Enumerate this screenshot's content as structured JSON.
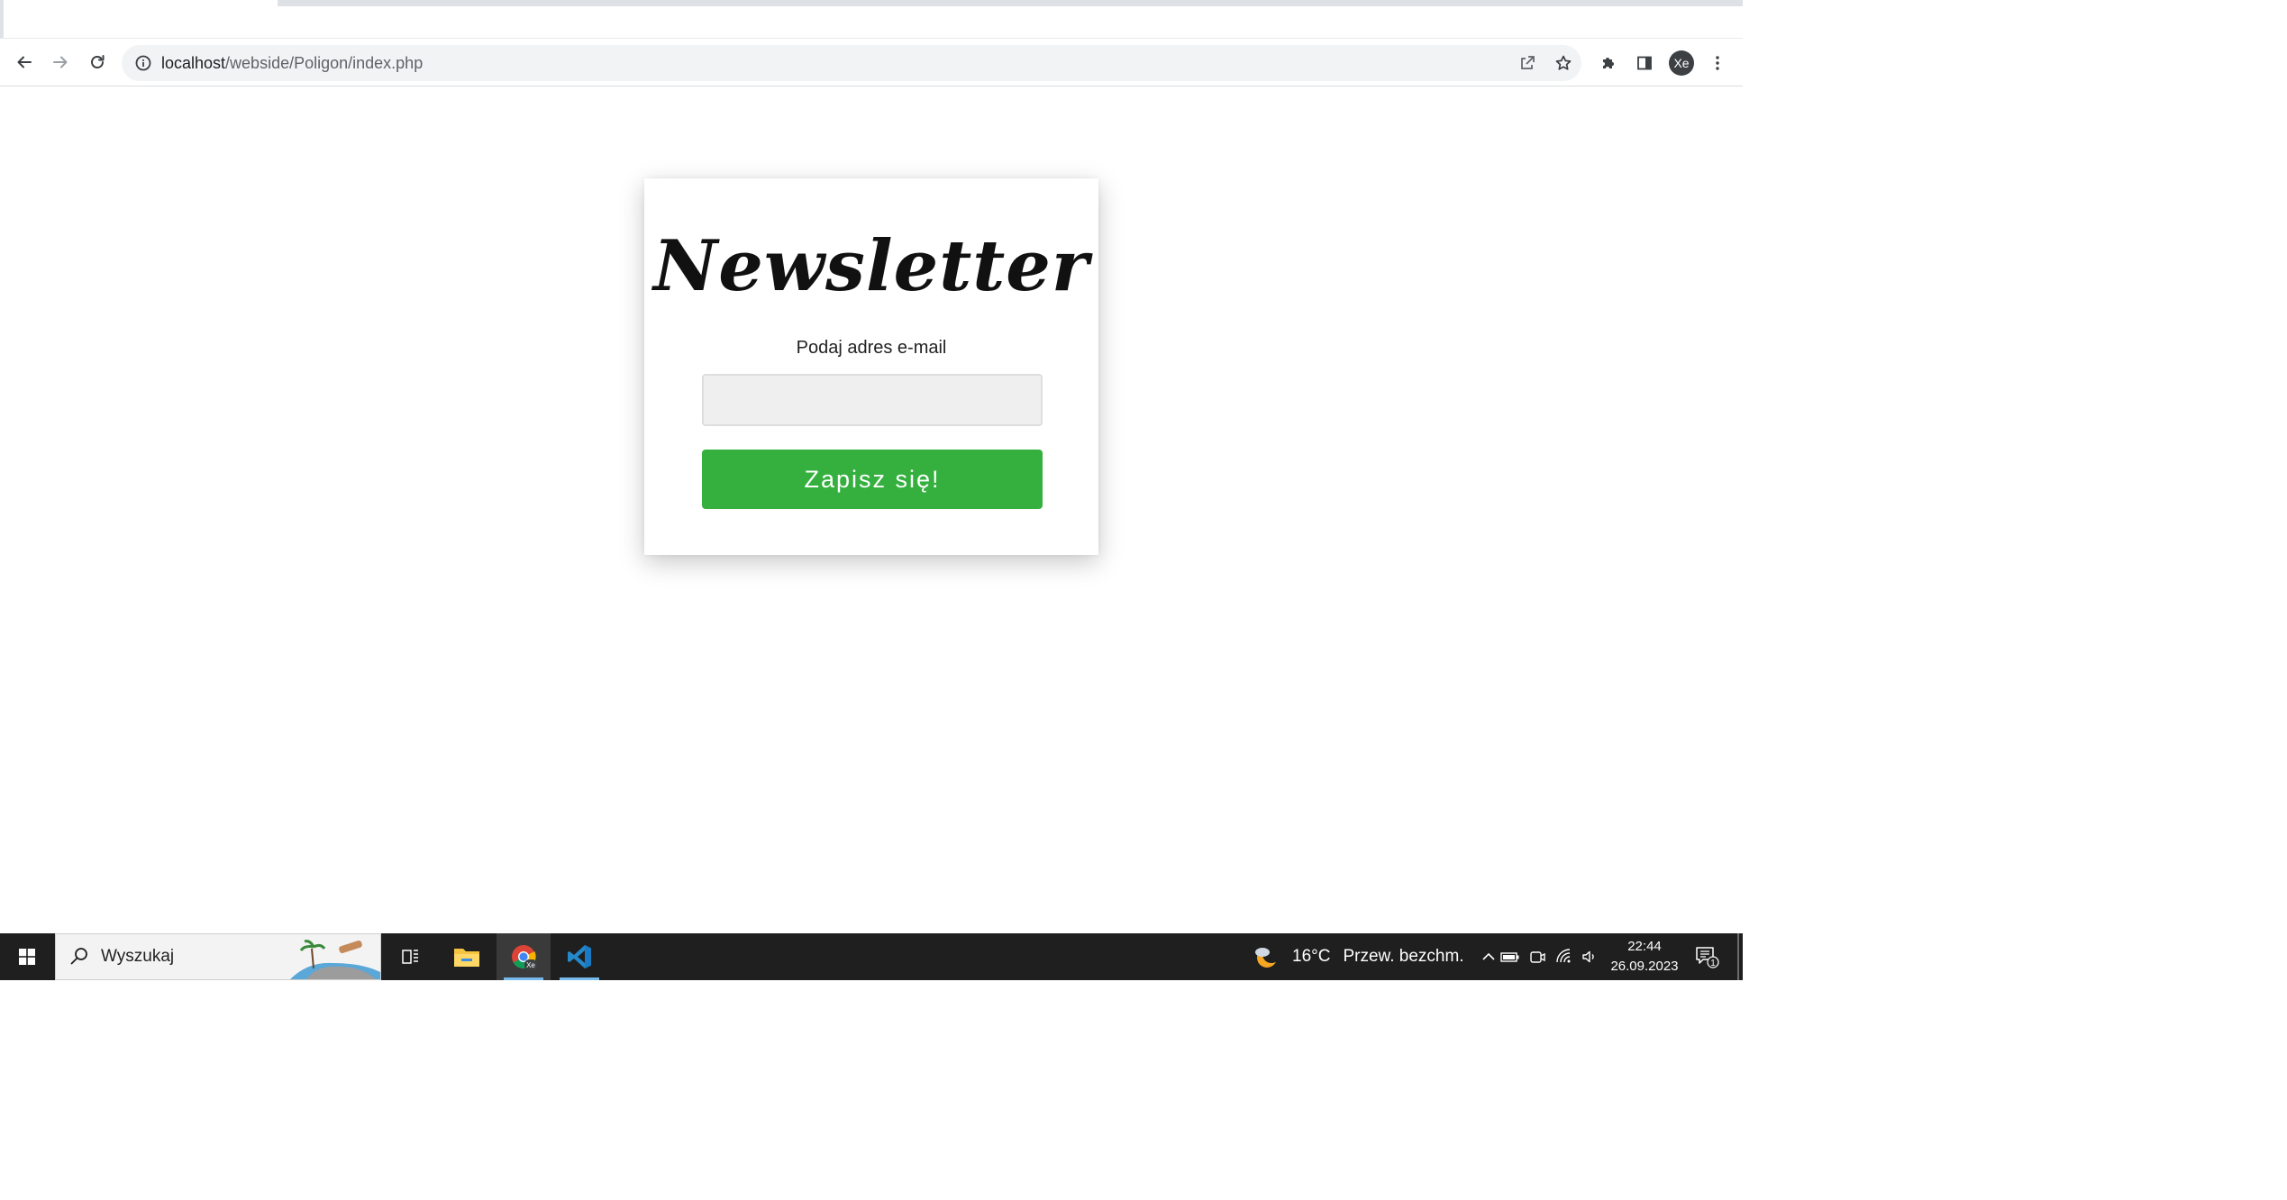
{
  "browser": {
    "url_host": "localhost",
    "url_path": "/webside/Poligon/index.php",
    "profile_initials": "Xe"
  },
  "page": {
    "title": "Newsletter",
    "email_label": "Podaj adres e-mail",
    "email_value": "",
    "submit_label": "Zapisz się!",
    "accent_color": "#35b03f"
  },
  "taskbar": {
    "search_placeholder": "Wyszukaj",
    "weather_temp": "16°C",
    "weather_text": "Przew. bezchm.",
    "time": "22:44",
    "date": "26.09.2023",
    "notification_count": "1",
    "chrome_badge": "Xe"
  },
  "icons": {
    "back": "arrow-left-icon",
    "forward": "arrow-right-icon",
    "reload": "reload-icon",
    "site_info": "info-icon",
    "share": "share-icon",
    "bookmark": "star-icon",
    "extensions": "puzzle-icon",
    "side_panel": "side-panel-icon",
    "menu": "kebab-menu-icon",
    "start": "windows-logo-icon",
    "search": "search-icon",
    "task_view": "task-view-icon",
    "file_explorer": "folder-icon",
    "chrome": "chrome-icon",
    "vscode": "vscode-icon",
    "weather": "moon-cloud-icon",
    "tray_chevron": "chevron-up-icon",
    "battery": "battery-icon",
    "meet_now": "camera-icon",
    "wifi": "wifi-icon",
    "volume": "speaker-icon",
    "notifications": "notification-icon"
  }
}
